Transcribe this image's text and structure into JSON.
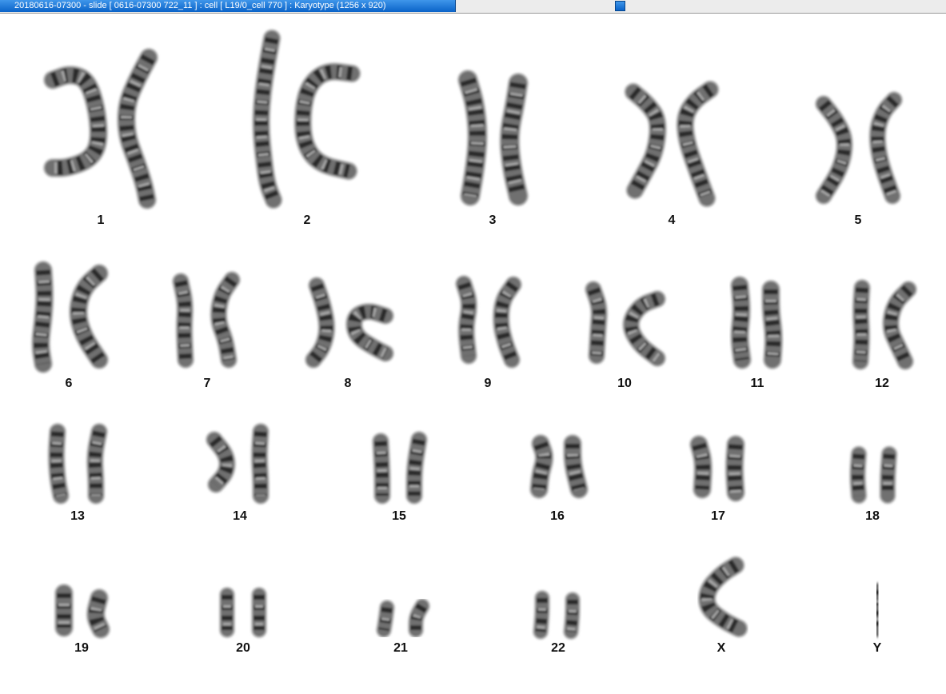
{
  "window": {
    "title": "20180616-07300 - slide [ 0616-07300 722_11 ] : cell [ L19/0_cell 770 ] : Karyotype  (1256 x 920)"
  },
  "karyotype": {
    "chromosomes": [
      {
        "id": "1",
        "label": "1"
      },
      {
        "id": "2",
        "label": "2"
      },
      {
        "id": "3",
        "label": "3"
      },
      {
        "id": "4",
        "label": "4"
      },
      {
        "id": "5",
        "label": "5"
      },
      {
        "id": "6",
        "label": "6"
      },
      {
        "id": "7",
        "label": "7"
      },
      {
        "id": "8",
        "label": "8"
      },
      {
        "id": "9",
        "label": "9"
      },
      {
        "id": "10",
        "label": "10"
      },
      {
        "id": "11",
        "label": "11"
      },
      {
        "id": "12",
        "label": "12"
      },
      {
        "id": "13",
        "label": "13"
      },
      {
        "id": "14",
        "label": "14"
      },
      {
        "id": "15",
        "label": "15"
      },
      {
        "id": "16",
        "label": "16"
      },
      {
        "id": "17",
        "label": "17"
      },
      {
        "id": "18",
        "label": "18"
      },
      {
        "id": "19",
        "label": "19"
      },
      {
        "id": "20",
        "label": "20"
      },
      {
        "id": "21",
        "label": "21"
      },
      {
        "id": "22",
        "label": "22"
      },
      {
        "id": "X",
        "label": "X"
      },
      {
        "id": "Y",
        "label": "Y"
      }
    ]
  }
}
